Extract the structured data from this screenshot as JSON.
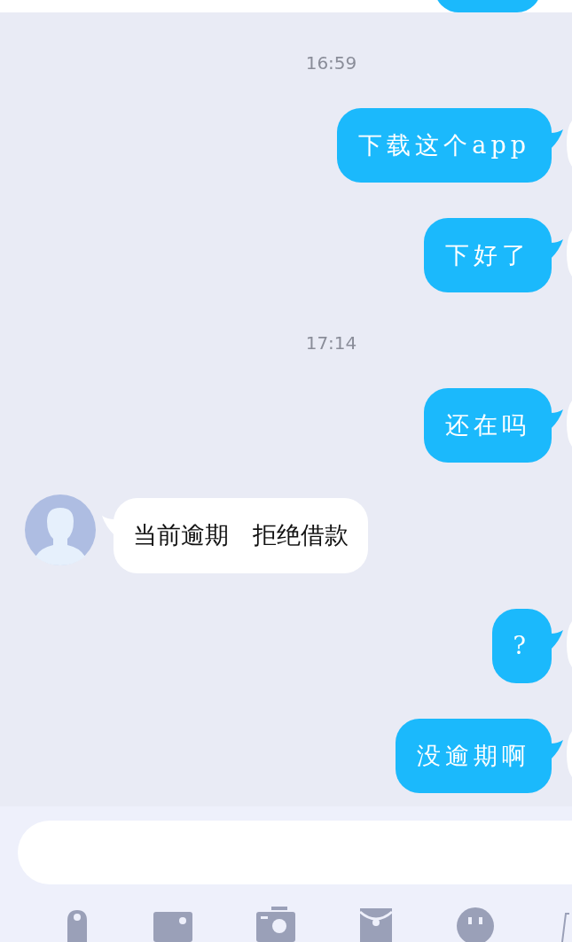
{
  "messages": [
    {
      "kind": "clipped"
    },
    {
      "kind": "time",
      "text": "16:59"
    },
    {
      "kind": "sent",
      "text": "下载这个app"
    },
    {
      "kind": "sent",
      "text": "下好了"
    },
    {
      "kind": "time",
      "text": "17:14"
    },
    {
      "kind": "sent",
      "text": "还在吗"
    },
    {
      "kind": "received",
      "text": "当前逾期　拒绝借款"
    },
    {
      "kind": "sent",
      "text": "?"
    },
    {
      "kind": "sent",
      "text": "没逾期啊"
    }
  ]
}
